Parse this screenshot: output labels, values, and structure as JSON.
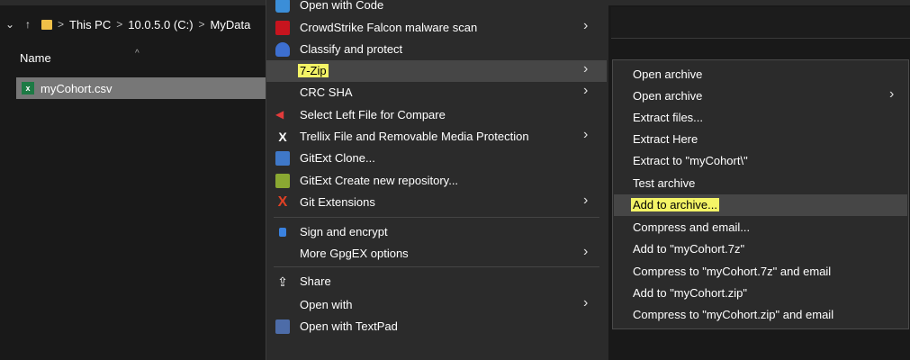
{
  "address_bar": {
    "crumbs": [
      "This PC",
      "10.0.5.0 (C:)",
      "MyData"
    ],
    "separator": ">"
  },
  "nav": {
    "expand_icon": "⌄",
    "up_icon": "↑"
  },
  "file_list": {
    "column_header": "Name",
    "sort_icon": "^",
    "file": "myCohort.csv",
    "file_icon_label": "x"
  },
  "context_menu": {
    "items": [
      {
        "label": "Open with Code",
        "icon": "vscode-icon"
      },
      {
        "label": "CrowdStrike Falcon malware scan",
        "icon": "falcon-icon",
        "submenu": true
      },
      {
        "label": "Classify and protect",
        "icon": "classify-icon"
      },
      {
        "label": "7-Zip",
        "icon": "none",
        "submenu": true,
        "highlighted": true
      },
      {
        "label": "CRC SHA",
        "icon": "none",
        "submenu": true
      },
      {
        "label": "Select Left File for Compare",
        "icon": "compare-icon"
      },
      {
        "label": "Trellix File and Removable Media Protection",
        "icon": "trellix-icon",
        "submenu": true
      },
      {
        "label": "GitExt Clone...",
        "icon": "gitext-icon"
      },
      {
        "label": "GitExt Create new repository...",
        "icon": "gitext-icon"
      },
      {
        "label": "Git Extensions",
        "icon": "git-icon",
        "submenu": true
      },
      {
        "label": "Sign and encrypt",
        "icon": "lock-icon"
      },
      {
        "label": "More GpgEX options",
        "icon": "none",
        "submenu": true
      },
      {
        "label": "Share",
        "icon": "share-icon"
      },
      {
        "label": "Open with",
        "icon": "none",
        "submenu": true
      },
      {
        "label": "Open with TextPad",
        "icon": "textpad-icon"
      }
    ],
    "arrow": "›",
    "trellix_glyph": "X",
    "git_glyph": "X",
    "share_glyph": "⇪",
    "compare_glyph": "◀"
  },
  "submenu": {
    "items": [
      {
        "label": "Open archive"
      },
      {
        "label": "Open archive",
        "submenu": true
      },
      {
        "label": "Extract files..."
      },
      {
        "label": "Extract Here"
      },
      {
        "label": "Extract to \"myCohort\\\""
      },
      {
        "label": "Test archive"
      },
      {
        "label": "Add to archive...",
        "highlighted": true
      },
      {
        "label": "Compress and email..."
      },
      {
        "label": "Add to \"myCohort.7z\""
      },
      {
        "label": "Compress to \"myCohort.7z\" and email"
      },
      {
        "label": "Add to \"myCohort.zip\""
      },
      {
        "label": "Compress to \"myCohort.zip\" and email"
      }
    ]
  },
  "colors": {
    "background": "#191919",
    "menu_bg": "#2b2b2b",
    "menu_hover": "#464646",
    "highlight_marker": "#f4f466",
    "selected_row": "#777777"
  }
}
